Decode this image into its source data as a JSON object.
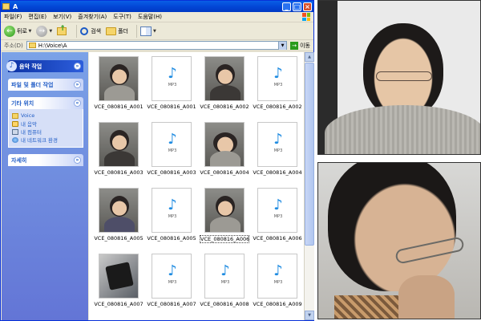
{
  "window": {
    "title": "A",
    "colors": {
      "titlebar": "#0347d6",
      "taskpane": "#6375d6",
      "link": "#215dc6"
    }
  },
  "menu": [
    "파일(F)",
    "편집(E)",
    "보기(V)",
    "즐겨찾기(A)",
    "도구(T)",
    "도움말(H)"
  ],
  "toolbar": {
    "back_label": "뒤로",
    "search_label": "검색",
    "folders_label": "폴더"
  },
  "address": {
    "label": "주소(D)",
    "value": "H:\\Voice\\A",
    "go_label": "이동"
  },
  "taskpane": {
    "music_tasks": "음악 작업",
    "file_folder_tasks": "파일 및 폴더 작업",
    "other_places": {
      "title": "기타 위치",
      "items": [
        {
          "label": "Voice",
          "icon": "folder-icon"
        },
        {
          "label": "내 음악",
          "icon": "music-folder-icon"
        },
        {
          "label": "내 컴퓨터",
          "icon": "computer-icon"
        },
        {
          "label": "내 네트워크 환경",
          "icon": "network-icon"
        }
      ]
    },
    "details": "자세히"
  },
  "files": [
    {
      "name": "VCE_080816_A001",
      "kind": "photo",
      "style": ""
    },
    {
      "name": "VCE_080816_A001",
      "kind": "mp3"
    },
    {
      "name": "VCE_080816_A002",
      "kind": "photo",
      "style": "dark"
    },
    {
      "name": "VCE_080816_A002",
      "kind": "mp3"
    },
    {
      "name": "VCE_080816_A003",
      "kind": "photo",
      "style": "dark"
    },
    {
      "name": "VCE_080816_A003",
      "kind": "mp3"
    },
    {
      "name": "VCE_080816_A004",
      "kind": "photo",
      "style": "hand"
    },
    {
      "name": "VCE_080816_A004",
      "kind": "mp3"
    },
    {
      "name": "VCE_080816_A005",
      "kind": "photo",
      "style": "phone"
    },
    {
      "name": "VCE_080816_A005",
      "kind": "mp3"
    },
    {
      "name": "VCE_080816_A006",
      "kind": "photo",
      "style": "",
      "selected": true
    },
    {
      "name": "VCE_080816_A006",
      "kind": "mp3"
    },
    {
      "name": "VCE_080816_A007",
      "kind": "device"
    },
    {
      "name": "VCE_080816_A007",
      "kind": "mp3"
    },
    {
      "name": "VCE_080816_A008",
      "kind": "mp3"
    },
    {
      "name": "VCE_080816_A009",
      "kind": "mp3"
    }
  ],
  "mp3_label": "MP3"
}
